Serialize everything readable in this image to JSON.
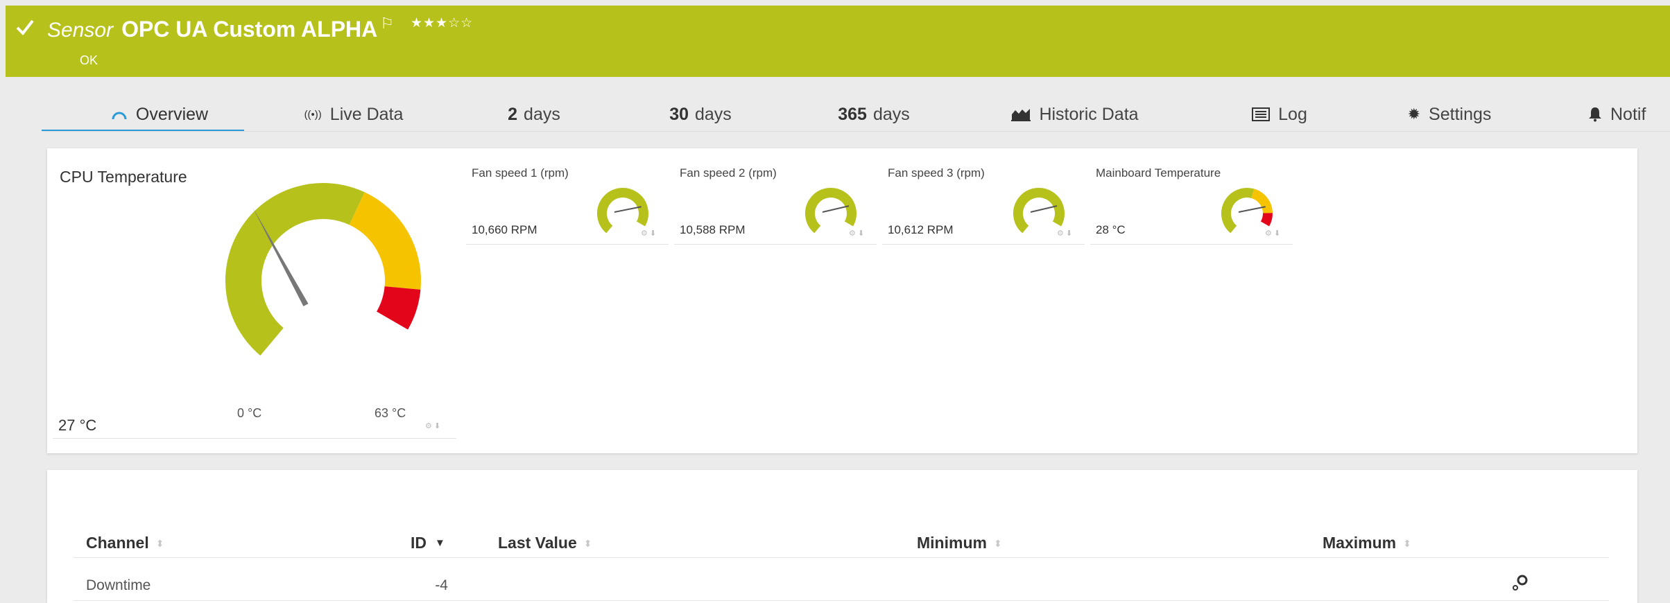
{
  "colors": {
    "header_bg": "#b6c11c",
    "gauge_green": "#b6c11c",
    "gauge_yellow": "#f5c300",
    "gauge_red": "#e3061b",
    "active_tab": "#2b9ad8"
  },
  "header": {
    "status_icon": "checkmark-icon",
    "kind": "Sensor",
    "name": "OPC UA Custom ALPHA",
    "flag_icon": "flag-icon",
    "priority_stars": "★★★☆☆",
    "status": "OK"
  },
  "tabs": [
    {
      "icon": "gauge-icon",
      "glyph": "◠",
      "bold": "",
      "label": "Overview",
      "active": true
    },
    {
      "icon": "live-signal-icon",
      "glyph": "((•))",
      "bold": "",
      "label": "Live Data"
    },
    {
      "icon": "",
      "glyph": "",
      "bold": "2",
      "label": "days"
    },
    {
      "icon": "",
      "glyph": "",
      "bold": "30",
      "label": "days"
    },
    {
      "icon": "",
      "glyph": "",
      "bold": "365",
      "label": "days"
    },
    {
      "icon": "area-chart-icon",
      "glyph": "",
      "bold": "",
      "label": "Historic Data"
    },
    {
      "icon": "log-list-icon",
      "glyph": "",
      "bold": "",
      "label": "Log"
    },
    {
      "icon": "gear-icon",
      "glyph": "✹",
      "bold": "",
      "label": "Settings"
    },
    {
      "icon": "bell-icon",
      "glyph": "",
      "bold": "",
      "label": "Notif"
    }
  ],
  "primary_gauge": {
    "title": "CPU Temperature",
    "value": 27,
    "value_text": "27 °C",
    "min": 0,
    "max": 63,
    "min_text": "0 °C",
    "max_text": "63 °C",
    "warning_from": 40,
    "error_from": 57
  },
  "mini_gauges": [
    {
      "title": "Fan speed 1 (rpm)",
      "value_text": "10,660 RPM",
      "fraction": 0.78,
      "warning_from": null,
      "error_from": null
    },
    {
      "title": "Fan speed 2 (rpm)",
      "value_text": "10,588 RPM",
      "fraction": 0.77,
      "warning_from": null,
      "error_from": null
    },
    {
      "title": "Fan speed 3 (rpm)",
      "value_text": "10,612 RPM",
      "fraction": 0.77,
      "warning_from": null,
      "error_from": null
    },
    {
      "title": "Mainboard Temperature",
      "value_text": "28 °C",
      "fraction": 0.78,
      "warning_from": 0.6,
      "error_from": 0.88
    }
  ],
  "table": {
    "columns": [
      {
        "label": "Channel",
        "sort": "sortable"
      },
      {
        "label": "ID",
        "sort": "descending"
      },
      {
        "label": "Last Value",
        "sort": "sortable"
      },
      {
        "label": "Minimum",
        "sort": "sortable"
      },
      {
        "label": "Maximum",
        "sort": "sortable"
      }
    ],
    "rows": [
      {
        "channel": "Downtime",
        "id": "-4",
        "last_value": "",
        "minimum": "",
        "maximum": "",
        "action_icon": "channel-settings-icon"
      }
    ]
  }
}
